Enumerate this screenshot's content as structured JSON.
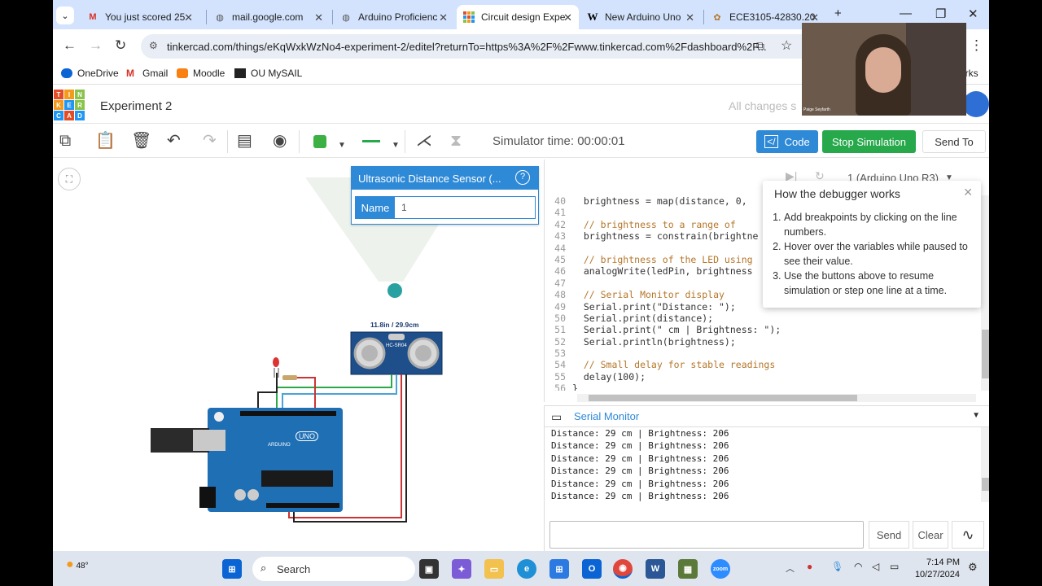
{
  "browser": {
    "tabs": [
      {
        "title": "You just scored 25",
        "icon": "gmail-icon"
      },
      {
        "title": "mail.google.com",
        "icon": "globe-icon"
      },
      {
        "title": "Arduino Proficienc",
        "icon": "globe-icon"
      },
      {
        "title": "Circuit design Expe",
        "icon": "tinkercad-icon",
        "active": true
      },
      {
        "title": "New Arduino Uno",
        "icon": "wikipedia-icon"
      },
      {
        "title": "ECE3105-42830.20",
        "icon": "canvas-icon"
      }
    ],
    "url": "tinkercad.com/things/eKqWxkWzNo4-experiment-2/editel?returnTo=https%3A%2F%2Fwww.tinkercad.com%2Fdashboard%2F...",
    "bookmarks": [
      {
        "label": "OneDrive",
        "icon": "onedrive-icon"
      },
      {
        "label": "Gmail",
        "icon": "gmail-icon"
      },
      {
        "label": "Moodle",
        "icon": "moodle-icon"
      },
      {
        "label": "OU MySAIL",
        "icon": "mysail-icon"
      }
    ],
    "bookmarks_overflow": "arks"
  },
  "app": {
    "logo_letters": [
      "T",
      "I",
      "N",
      "K",
      "E",
      "R",
      "C",
      "A",
      "D"
    ],
    "project_title": "Experiment 2",
    "save_status": "All changes s"
  },
  "toolbar": {
    "sim_time": "Simulator time: 00:00:01",
    "code_label": "Code",
    "stop_label": "Stop Simulation",
    "send_to_label": "Send To",
    "color_swatch": "#3cb043"
  },
  "inspector": {
    "title": "Ultrasonic Distance Sensor (...",
    "name_label": "Name",
    "name_value": "1"
  },
  "canvas": {
    "sensor_readout": "11.8in / 29.9cm",
    "sensor_label": "HC-SR04",
    "board_label": "UNO",
    "board_brand": "ARDUINO"
  },
  "code": {
    "device": "1 (Arduino Uno R3)",
    "lines": [
      {
        "n": "40",
        "text": "  brightness = map(distance, 0, ",
        "kind": "tx"
      },
      {
        "n": "41",
        "text": "",
        "kind": "tx"
      },
      {
        "n": "42",
        "text": "  // brightness to a range of ",
        "kind": "cm"
      },
      {
        "n": "43",
        "text": "  brightness = constrain(brightne",
        "kind": "tx"
      },
      {
        "n": "44",
        "text": "",
        "kind": "tx"
      },
      {
        "n": "45",
        "text": "  // brightness of the LED using",
        "kind": "cm"
      },
      {
        "n": "46",
        "text": "  analogWrite(ledPin, brightness",
        "kind": "tx"
      },
      {
        "n": "47",
        "text": "",
        "kind": "tx"
      },
      {
        "n": "48",
        "text": "  // Serial Monitor display",
        "kind": "cm"
      },
      {
        "n": "49",
        "text": "  Serial.print(\"Distance: \");",
        "kind": "tx"
      },
      {
        "n": "50",
        "text": "  Serial.print(distance);",
        "kind": "tx"
      },
      {
        "n": "51",
        "text": "  Serial.print(\" cm | Brightness: \");",
        "kind": "tx"
      },
      {
        "n": "52",
        "text": "  Serial.println(brightness);",
        "kind": "tx"
      },
      {
        "n": "53",
        "text": "",
        "kind": "tx"
      },
      {
        "n": "54",
        "text": "  // Small delay for stable readings",
        "kind": "cm"
      },
      {
        "n": "55",
        "text": "  delay(100);",
        "kind": "tx"
      },
      {
        "n": "56",
        "text": "}",
        "kind": "tx"
      }
    ]
  },
  "debugger_tip": {
    "title": "How the debugger works",
    "steps": [
      "Add breakpoints by clicking on the line numbers.",
      "Hover over the variables while paused to see their value.",
      "Use the buttons above to resume simulation or step one line at a time."
    ]
  },
  "serial": {
    "title": "Serial Monitor",
    "output": [
      "Distance: 29 cm | Brightness: 206",
      "Distance: 29 cm | Brightness: 206",
      "Distance: 29 cm | Brightness: 206",
      "Distance: 29 cm | Brightness: 206",
      "Distance: 29 cm | Brightness: 206",
      "Distance: 29 cm | Brightness: 206"
    ],
    "send_label": "Send",
    "clear_label": "Clear"
  },
  "taskbar": {
    "weather": "48°",
    "search_placeholder": "Search",
    "time": "7:14 PM",
    "date": "10/27/2024"
  },
  "webcam": {
    "name": "Paige Seyfarth"
  }
}
